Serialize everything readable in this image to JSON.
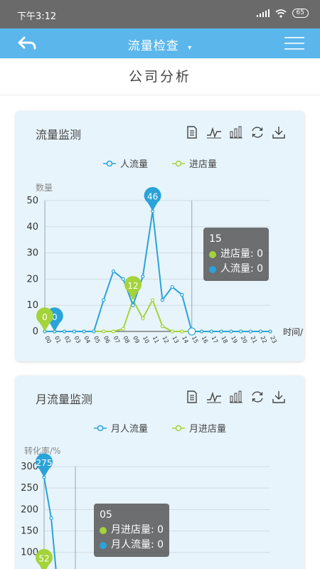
{
  "status_bar": {
    "time": "下午3:12",
    "battery": "65"
  },
  "app_bar": {
    "title": "流量检查",
    "dropdown_icon": "caret-down-icon",
    "back_icon": "back-arrow-icon",
    "menu_icon": "hamburger-menu-icon"
  },
  "page_title": "公司分析",
  "colors": {
    "series_people": "#2aa3d9",
    "series_store": "#a4d33a",
    "app_bar": "#5bb6ec",
    "card_bg": "#e7f4fb"
  },
  "toolbar_icons": [
    "data-view-icon",
    "line-chart-icon",
    "bar-chart-icon",
    "refresh-icon",
    "download-icon"
  ],
  "card1": {
    "title": "流量监测",
    "legend": [
      "人流量",
      "进店量"
    ],
    "tooltip": {
      "title": "15",
      "rows": [
        {
          "label": "进店量: 0"
        },
        {
          "label": "人流量: 0"
        }
      ]
    }
  },
  "card2": {
    "title": "月流量监测",
    "legend": [
      "月人流量",
      "月进店量"
    ],
    "tooltip": {
      "title": "05",
      "rows": [
        {
          "label": "月进店量: 0"
        },
        {
          "label": "月人流量: 0"
        }
      ]
    }
  },
  "chart_data": [
    {
      "type": "line",
      "xlabel": "时间/",
      "ylabel": "数量",
      "ylim": [
        0,
        50
      ],
      "yticks": [
        0,
        10,
        20,
        30,
        40,
        50
      ],
      "x": [
        "00",
        "01",
        "02",
        "03",
        "04",
        "05",
        "06",
        "07",
        "08",
        "09",
        "10",
        "11",
        "12",
        "13",
        "14",
        "15",
        "16",
        "17",
        "18",
        "19",
        "20",
        "21",
        "22",
        "23"
      ],
      "series": [
        {
          "name": "人流量",
          "values": [
            0,
            0,
            0,
            0,
            0,
            0,
            12,
            23,
            20,
            10,
            21,
            46,
            12,
            17,
            14,
            0,
            0,
            0,
            0,
            0,
            0,
            0,
            0,
            0
          ],
          "pins": [
            {
              "index": 1,
              "label": "0"
            },
            {
              "index": 11,
              "label": "46"
            }
          ]
        },
        {
          "name": "进店量",
          "values": [
            0,
            0,
            0,
            0,
            0,
            0,
            0,
            0,
            1,
            12,
            5,
            12,
            2,
            0,
            0,
            0,
            0,
            0,
            0,
            0,
            0,
            0,
            0,
            0
          ],
          "pins": [
            {
              "index": 0,
              "label": "0"
            },
            {
              "index": 9,
              "label": "12"
            }
          ]
        }
      ],
      "cursor_index": 15,
      "grid": true,
      "legend_position": "top-center"
    },
    {
      "type": "line",
      "xlabel": "",
      "ylabel": "转化率/%",
      "yticks": [
        100,
        150,
        200,
        250,
        300
      ],
      "ylim": [
        0,
        300
      ],
      "series": [
        {
          "name": "月人流量",
          "values": [
            275,
            180,
            0
          ],
          "pins": [
            {
              "index": 0,
              "label": "275"
            }
          ]
        },
        {
          "name": "月进店量",
          "values": [
            52
          ],
          "pins": [
            {
              "index": 0,
              "label": "52"
            }
          ]
        }
      ],
      "cursor_label": "05",
      "grid": true,
      "legend_position": "top-center"
    }
  ]
}
